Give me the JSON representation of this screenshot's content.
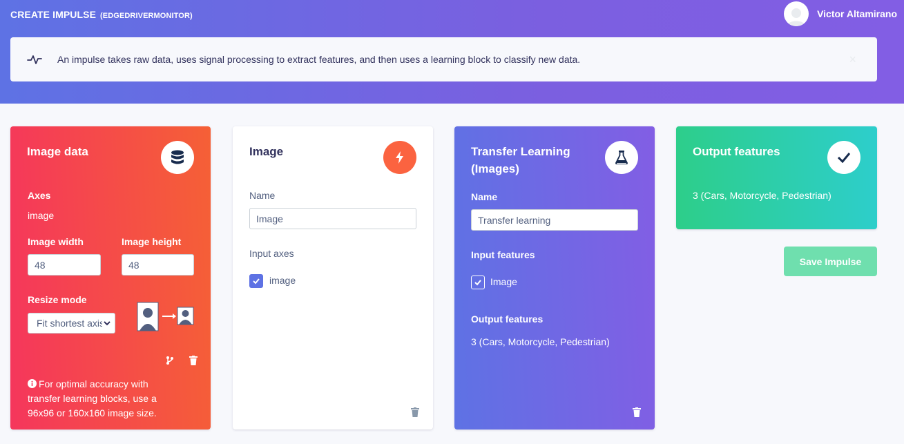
{
  "header": {
    "title": "CREATE IMPULSE",
    "project": "(EDGEDRIVERMONITOR)",
    "user_name": "Victor Altamirano"
  },
  "alert": {
    "text": "An impulse takes raw data, uses signal processing to extract features, and then uses a learning block to classify new data.",
    "close": "×"
  },
  "input_block": {
    "title": "Image data",
    "icon": "database-icon",
    "axes_label": "Axes",
    "axes_value": "image",
    "width_label": "Image width",
    "width_value": "48",
    "height_label": "Image height",
    "height_value": "48",
    "resize_label": "Resize mode",
    "resize_value": "Fit shortest axis",
    "note": "For optimal accuracy with transfer learning blocks, use a 96x96 or 160x160 image size."
  },
  "processing_block": {
    "title": "Image",
    "icon": "bolt-icon",
    "name_label": "Name",
    "name_value": "Image",
    "axes_label": "Input axes",
    "axes": [
      "image"
    ]
  },
  "learning_block": {
    "title": "Transfer Learning (Images)",
    "icon": "flask-icon",
    "name_label": "Name",
    "name_value": "Transfer learning",
    "features_label": "Input features",
    "features": [
      "Image"
    ],
    "output_label": "Output features",
    "output_value": "3 (Cars, Motorcycle, Pedestrian)"
  },
  "output_block": {
    "title": "Output features",
    "icon": "check-icon",
    "value": "3 (Cars, Motorcycle, Pedestrian)"
  },
  "actions": {
    "save": "Save Impulse"
  },
  "colors": {
    "header": "#5e72e4",
    "input_block": "#f5365c",
    "processing_accent": "#fb6340",
    "learning_block": "#825ee4",
    "output_block": "#2dce89",
    "checkbox": "#5e72e4"
  }
}
